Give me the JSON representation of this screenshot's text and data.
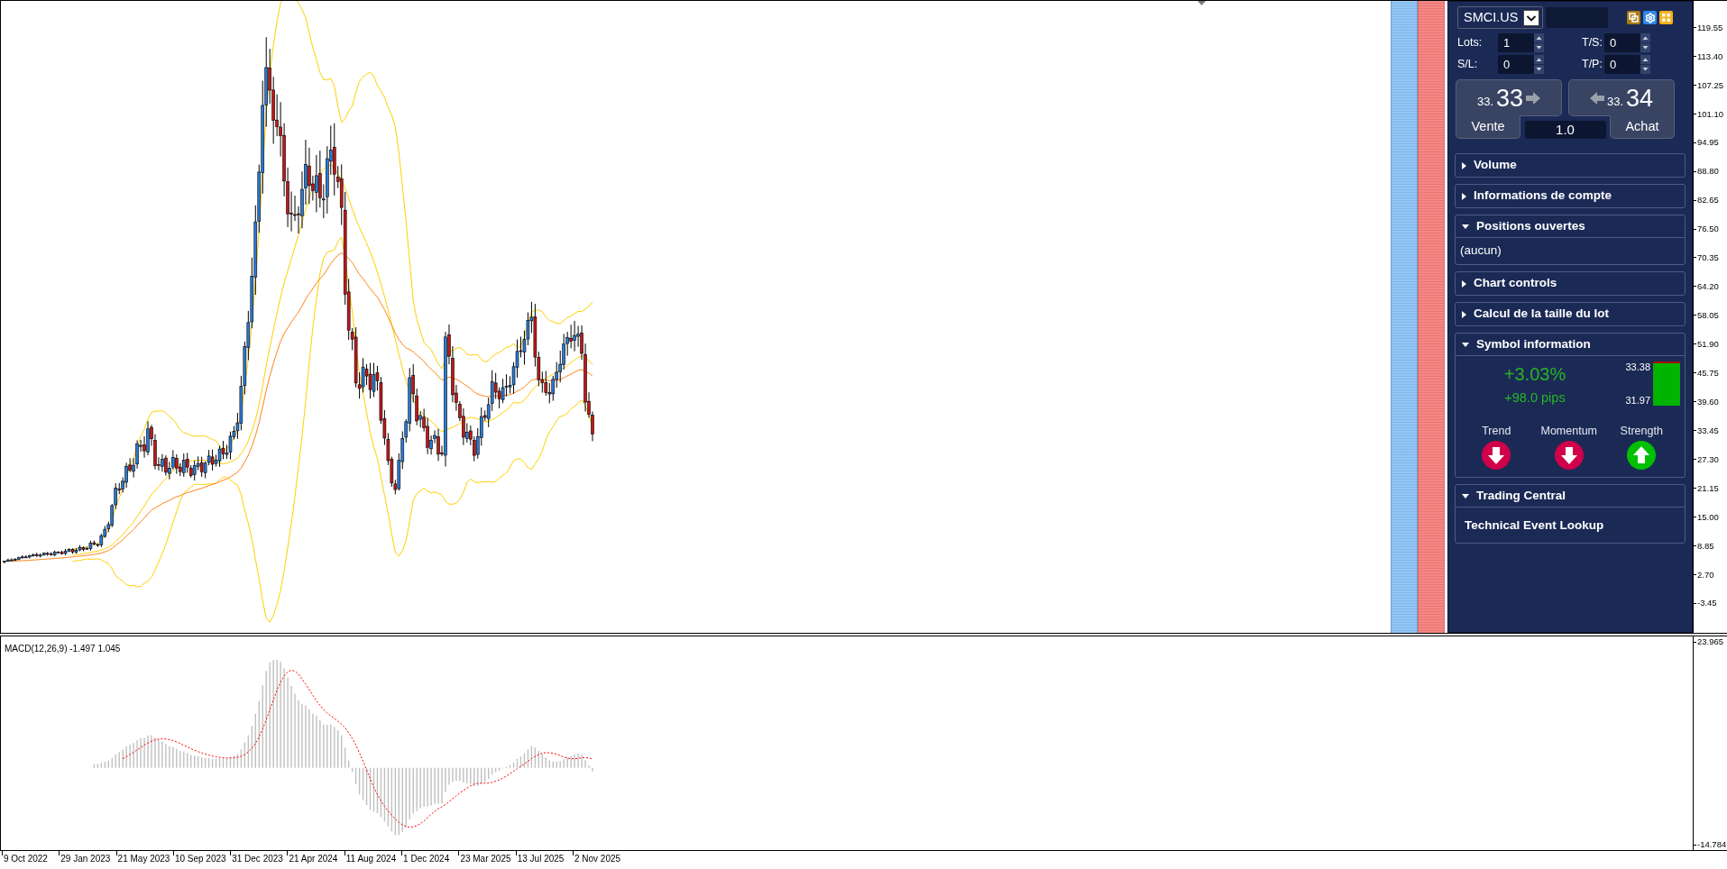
{
  "chart": {
    "price_axis": [
      "119.55",
      "113.40",
      "107.25",
      "101.10",
      "94.95",
      "88.80",
      "82.65",
      "76.50",
      "70.35",
      "64.20",
      "58.05",
      "51.90",
      "45.75",
      "39.60",
      "33.45",
      "27.30",
      "21.15",
      "15.00",
      "8.85",
      "2.70",
      "-3.45"
    ],
    "indicator": {
      "label": "MACD(12,26,9) -1.497 1.045",
      "axis": [
        "23.965",
        "-14.784"
      ]
    },
    "date_axis": [
      "9 Oct 2022",
      "29 Jan 2023",
      "21 May 2023",
      "10 Sep 2023",
      "31 Dec 2023",
      "21 Apr 2024",
      "11 Aug 2024",
      "1 Dec 2024",
      "23 Mar 2025",
      "13 Jul 2025",
      "2 Nov 2025"
    ]
  },
  "trade_panel": {
    "symbol": "SMCI.US",
    "fields": [
      {
        "label": "Lots:",
        "value": "1"
      },
      {
        "label": "T/S:",
        "value": "0"
      },
      {
        "label": "S/L:",
        "value": "0"
      },
      {
        "label": "T/P:",
        "value": "0"
      }
    ],
    "sell": {
      "price_prefix": "33.",
      "price_main": "33",
      "label": "Vente"
    },
    "buy": {
      "price_prefix": "33.",
      "price_main": "34",
      "label": "Achat"
    },
    "quantity": "1.0",
    "sections": [
      {
        "title": "Volume",
        "expanded": false
      },
      {
        "title": "Informations de compte",
        "expanded": false
      },
      {
        "title": "Positions ouvertes",
        "expanded": true,
        "kind": "text",
        "text": "(aucun)"
      },
      {
        "title": "Chart controls",
        "expanded": false
      },
      {
        "title": "Calcul de la taille du lot",
        "expanded": false
      },
      {
        "title": "Symbol information",
        "expanded": true,
        "kind": "symbol_info",
        "change": "+3.03%",
        "pips": "+98.0 pips",
        "range_high": "33.38",
        "range_low": "31.97",
        "level": 0.96,
        "signals": [
          {
            "label": "Trend",
            "rising": false
          },
          {
            "label": "Momentum",
            "rising": false
          },
          {
            "label": "Strength",
            "rising": true
          }
        ]
      },
      {
        "title": "Trading Central",
        "expanded": true,
        "kind": "links",
        "links": [
          "Technical Event Lookup"
        ]
      }
    ]
  }
}
